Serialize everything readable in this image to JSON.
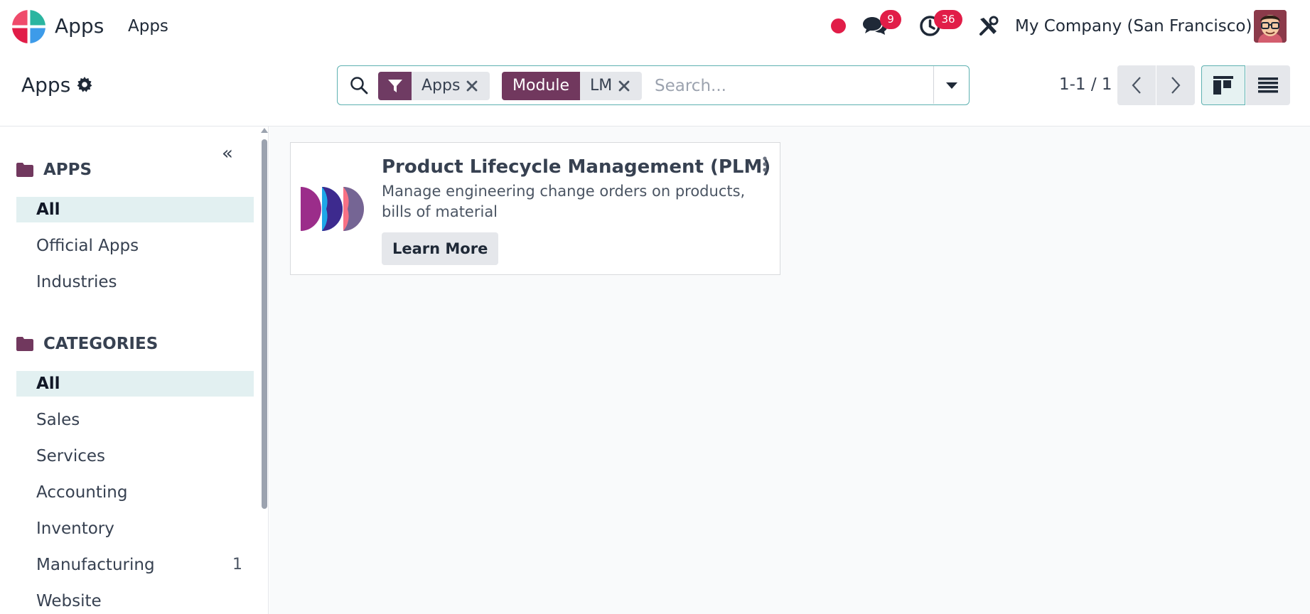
{
  "navbar": {
    "brand": "Apps",
    "menu_item": "Apps",
    "messages_count": "9",
    "activities_count": "36",
    "company": "My Company (San Francisco)"
  },
  "control_panel": {
    "title": "Apps",
    "search": {
      "facet1_value": "Apps",
      "facet2_label": "Module",
      "facet2_value": "LM",
      "placeholder": "Search..."
    },
    "pager": "1-1 / 1"
  },
  "sidebar": {
    "apps_section": {
      "title": "APPS",
      "items": [
        {
          "label": "All",
          "active": true
        },
        {
          "label": "Official Apps"
        },
        {
          "label": "Industries"
        }
      ]
    },
    "categories_section": {
      "title": "CATEGORIES",
      "items": [
        {
          "label": "All",
          "active": true
        },
        {
          "label": "Sales"
        },
        {
          "label": "Services"
        },
        {
          "label": "Accounting"
        },
        {
          "label": "Inventory"
        },
        {
          "label": "Manufacturing",
          "count": "1"
        },
        {
          "label": "Website"
        }
      ]
    }
  },
  "kanban": {
    "cards": [
      {
        "title": "Product Lifecycle Management (PLM)",
        "description": "Manage engineering change orders on products, bills of material",
        "button": "Learn More"
      }
    ]
  },
  "colors": {
    "facet_purple": "#71385e",
    "badge_red": "#e11d48",
    "accent_teal": "#5eb1b1",
    "active_item_bg": "#e2f0f1"
  }
}
